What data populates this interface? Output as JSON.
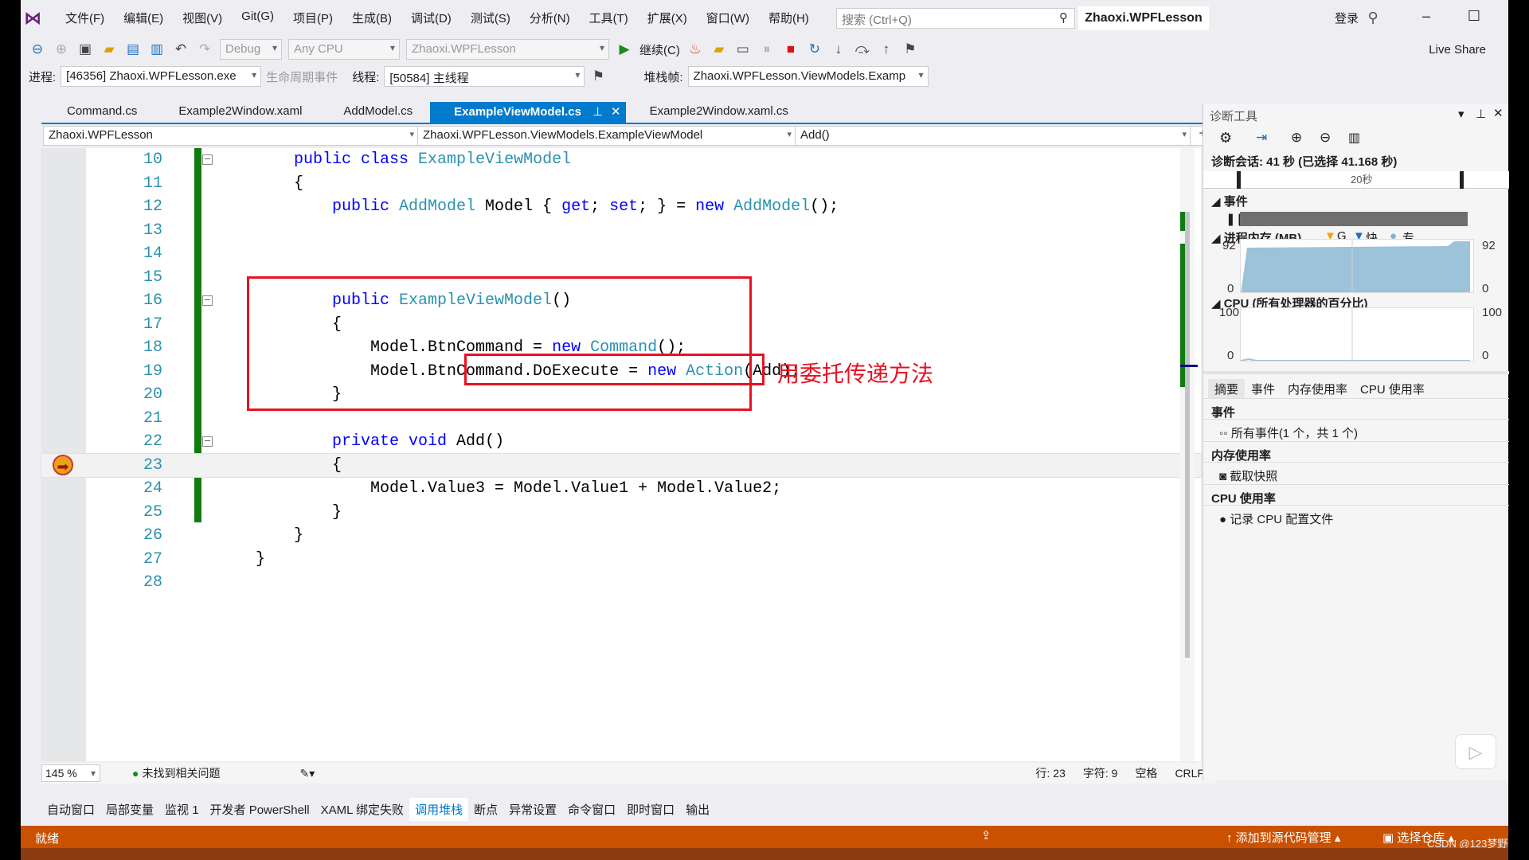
{
  "menu": {
    "items": [
      "文件(F)",
      "编辑(E)",
      "视图(V)",
      "Git(G)",
      "项目(P)",
      "生成(B)",
      "调试(D)",
      "测试(S)",
      "分析(N)",
      "工具(T)",
      "扩展(X)",
      "窗口(W)",
      "帮助(H)"
    ],
    "search_placeholder": "搜索 (Ctrl+Q)",
    "title": "Zhaoxi.WPFLesson",
    "login": "登录"
  },
  "toolbar": {
    "config": "Debug",
    "platform": "Any CPU",
    "startup": "Zhaoxi.WPFLesson",
    "continue": "继续(C)",
    "live_share": "Live Share"
  },
  "debugbar": {
    "process_label": "进程:",
    "process": "[46356] Zhaoxi.WPFLesson.exe",
    "lifecycle": "生命周期事件",
    "thread_label": "线程:",
    "thread": "[50584] 主线程",
    "stack_label": "堆栈帧:",
    "stack": "Zhaoxi.WPFLesson.ViewModels.Examp"
  },
  "tabs": [
    {
      "label": "Command.cs"
    },
    {
      "label": "Example2Window.xaml"
    },
    {
      "label": "AddModel.cs"
    },
    {
      "label": "ExampleViewModel.cs",
      "active": true
    },
    {
      "label": "Example2Window.xaml.cs"
    }
  ],
  "nav": {
    "project": "Zhaoxi.WPFLesson",
    "class": "Zhaoxi.WPFLesson.ViewModels.ExampleViewModel",
    "member": "Add()"
  },
  "code": [
    {
      "n": "10",
      "t": [
        [
          "    public ",
          "kw"
        ],
        [
          "class ",
          "kw"
        ],
        [
          "ExampleViewModel",
          "ty"
        ]
      ]
    },
    {
      "n": "11",
      "t": [
        [
          "    {",
          "pl"
        ]
      ]
    },
    {
      "n": "12",
      "t": [
        [
          "        public ",
          "kw"
        ],
        [
          "AddModel",
          "ty"
        ],
        [
          " Model { ",
          "pl"
        ],
        [
          "get",
          "kw"
        ],
        [
          "; ",
          "pl"
        ],
        [
          "set",
          "kw"
        ],
        [
          "; } = ",
          "pl"
        ],
        [
          "new ",
          "kw"
        ],
        [
          "AddModel",
          "ty"
        ],
        [
          "();",
          "pl"
        ]
      ]
    },
    {
      "n": "13",
      "t": []
    },
    {
      "n": "14",
      "t": []
    },
    {
      "n": "15",
      "t": []
    },
    {
      "n": "16",
      "t": [
        [
          "        public ",
          "kw"
        ],
        [
          "ExampleViewModel",
          "ty"
        ],
        [
          "()",
          "pl"
        ]
      ]
    },
    {
      "n": "17",
      "t": [
        [
          "        {",
          "pl"
        ]
      ]
    },
    {
      "n": "18",
      "t": [
        [
          "            Model.BtnCommand = ",
          "pl"
        ],
        [
          "new ",
          "kw"
        ],
        [
          "Command",
          "ty"
        ],
        [
          "();",
          "pl"
        ]
      ]
    },
    {
      "n": "19",
      "t": [
        [
          "            Model.BtnCommand.DoExecute = ",
          "pl"
        ],
        [
          "new ",
          "kw"
        ],
        [
          "Action",
          "ty"
        ],
        [
          "(Add);",
          "pl"
        ]
      ]
    },
    {
      "n": "20",
      "t": [
        [
          "        }",
          "pl"
        ]
      ]
    },
    {
      "n": "21",
      "t": []
    },
    {
      "n": "22",
      "t": [
        [
          "        private ",
          "kw"
        ],
        [
          "void ",
          "kw"
        ],
        [
          "Add",
          "pl"
        ],
        [
          "()",
          "pl"
        ]
      ]
    },
    {
      "n": "23",
      "t": [
        [
          "        {",
          "pl"
        ]
      ]
    },
    {
      "n": "24",
      "t": [
        [
          "            Model.Value3 = Model.Value1 + Model.Value2;",
          "pl"
        ]
      ]
    },
    {
      "n": "25",
      "t": [
        [
          "        }",
          "pl"
        ]
      ]
    },
    {
      "n": "26",
      "t": [
        [
          "    }",
          "pl"
        ]
      ]
    },
    {
      "n": "27",
      "t": [
        [
          "}",
          "pl"
        ]
      ]
    },
    {
      "n": "28",
      "t": []
    }
  ],
  "annotation": "用委托传递方法",
  "editor_status": {
    "zoom": "145 %",
    "issues": "未找到相关问题",
    "line": "行: 23",
    "col": "字符: 9",
    "spaces": "空格",
    "eol": "CRLF"
  },
  "bottom_tabs": [
    "自动窗口",
    "局部变量",
    "监视 1",
    "开发者 PowerShell",
    "XAML 绑定失败",
    "调用堆栈",
    "断点",
    "异常设置",
    "命令窗口",
    "即时窗口",
    "输出"
  ],
  "bottom_active": "调用堆栈",
  "statusbar": {
    "ready": "就绪",
    "source_control": "添加到源代码管理",
    "repo": "选择仓库",
    "watermark": "CSDN @123梦野"
  },
  "diag": {
    "title": "诊断工具",
    "session": "诊断会话: 41 秒 (已选择 41.168 秒)",
    "timeline_tick": "20秒",
    "events": "事件",
    "memory": "进程内存 (MB)",
    "legend": [
      "G",
      "快",
      "专..."
    ],
    "mem_max": "92",
    "mem_min": "0",
    "cpu": "CPU (所有处理器的百分比)",
    "cpu_max": "100",
    "cpu_min": "0",
    "tabs": [
      "摘要",
      "事件",
      "内存使用率",
      "CPU 使用率"
    ],
    "sec_events": "事件",
    "all_events": "所有事件(1 个，共 1 个)",
    "sec_memory": "内存使用率",
    "snapshot": "截取快照",
    "sec_cpu": "CPU 使用率",
    "record_cpu": "记录 CPU 配置文件"
  },
  "colors": {
    "accent": "#007acc",
    "status": "#ca5100",
    "keyword": "#0000ff",
    "type": "#2b91af",
    "annotation": "#e81123",
    "memory_fill": "#9cc3da"
  }
}
